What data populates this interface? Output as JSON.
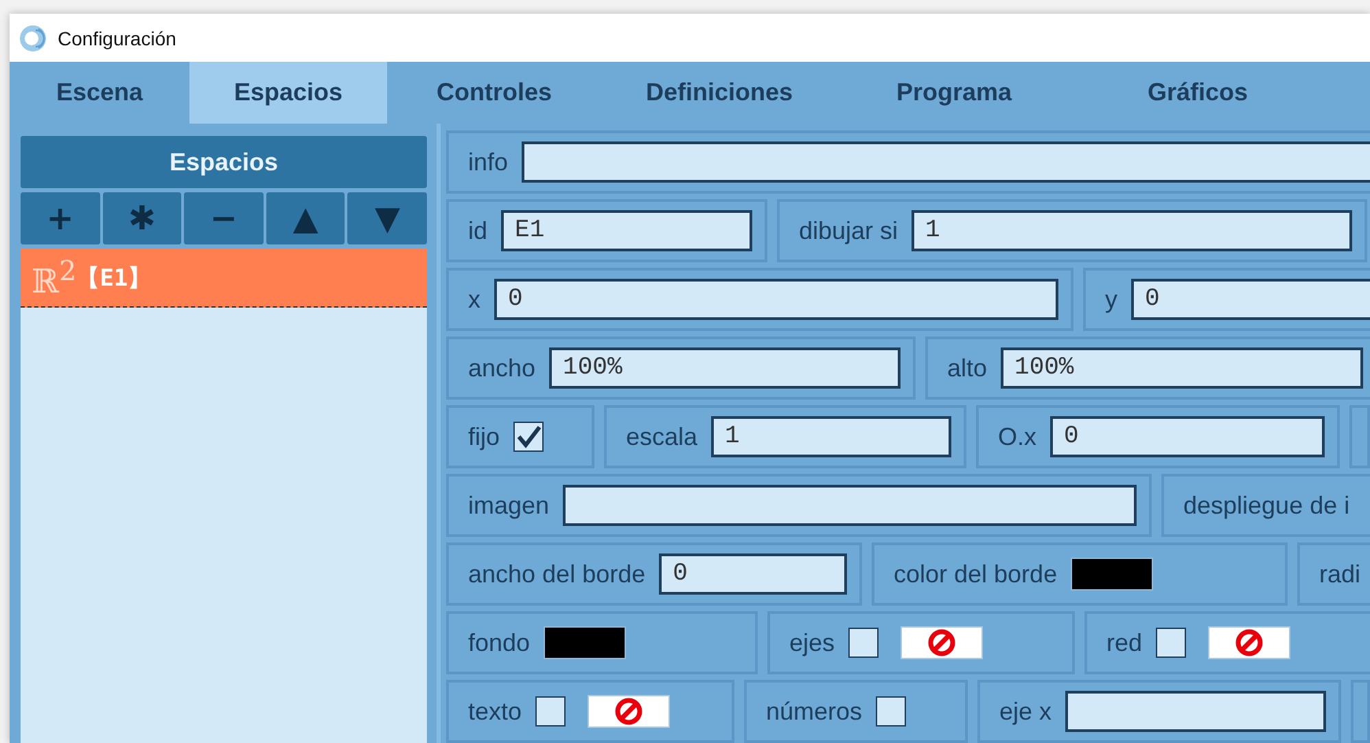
{
  "window": {
    "title": "Configuración"
  },
  "tabs": [
    {
      "label": "Escena",
      "selected": false
    },
    {
      "label": "Espacios",
      "selected": true
    },
    {
      "label": "Controles",
      "selected": false
    },
    {
      "label": "Definiciones",
      "selected": false
    },
    {
      "label": "Programa",
      "selected": false
    },
    {
      "label": "Gráficos",
      "selected": false
    }
  ],
  "sidebar": {
    "title": "Espacios",
    "tools": [
      "+",
      "✱",
      "−",
      "▲",
      "▼"
    ],
    "items": [
      {
        "symbol": "ℝ$^{2}$",
        "label": "【E1】",
        "selected": true
      }
    ]
  },
  "rows": [
    {
      "cells": [
        {
          "kind": "field",
          "label": "info"
        }
      ]
    },
    {
      "cells": [
        {
          "kind": "field",
          "label": "id",
          "value": "E1"
        },
        {
          "kind": "field",
          "label": "dibujar si",
          "value": "1"
        }
      ]
    },
    {
      "cells": [
        {
          "kind": "field",
          "label": "x",
          "value": "0"
        },
        {
          "kind": "field",
          "label": "y",
          "value": "0"
        }
      ]
    },
    {
      "cells": [
        {
          "kind": "field",
          "label": "ancho",
          "value": "100%"
        },
        {
          "kind": "field",
          "label": "alto",
          "value": "100%"
        }
      ]
    },
    {
      "cells": [
        {
          "kind": "check",
          "label": "fijo",
          "checked": true
        },
        {
          "kind": "field",
          "label": "escala",
          "value": "1"
        },
        {
          "kind": "field",
          "label": "O.x",
          "value": "0"
        }
      ]
    },
    {
      "cells": [
        {
          "kind": "field",
          "label": "imagen"
        },
        {
          "kind": "label",
          "label": "despliegue de i"
        }
      ]
    },
    {
      "cells": [
        {
          "kind": "field",
          "label": "ancho del borde",
          "value": "0"
        },
        {
          "kind": "color",
          "label": "color del borde",
          "color": "#000000"
        },
        {
          "kind": "label",
          "label": "radi"
        }
      ]
    },
    {
      "cells": [
        {
          "kind": "color",
          "label": "fondo",
          "color": "#000000"
        },
        {
          "kind": "checkcolor",
          "label": "ejes",
          "checked": false
        },
        {
          "kind": "checkcolor",
          "label": "red",
          "checked": false
        }
      ]
    },
    {
      "cells": [
        {
          "kind": "checkcolor",
          "label": "texto",
          "checked": false
        },
        {
          "kind": "check",
          "label": "números",
          "checked": false
        },
        {
          "kind": "field",
          "label": "eje x"
        }
      ]
    }
  ]
}
